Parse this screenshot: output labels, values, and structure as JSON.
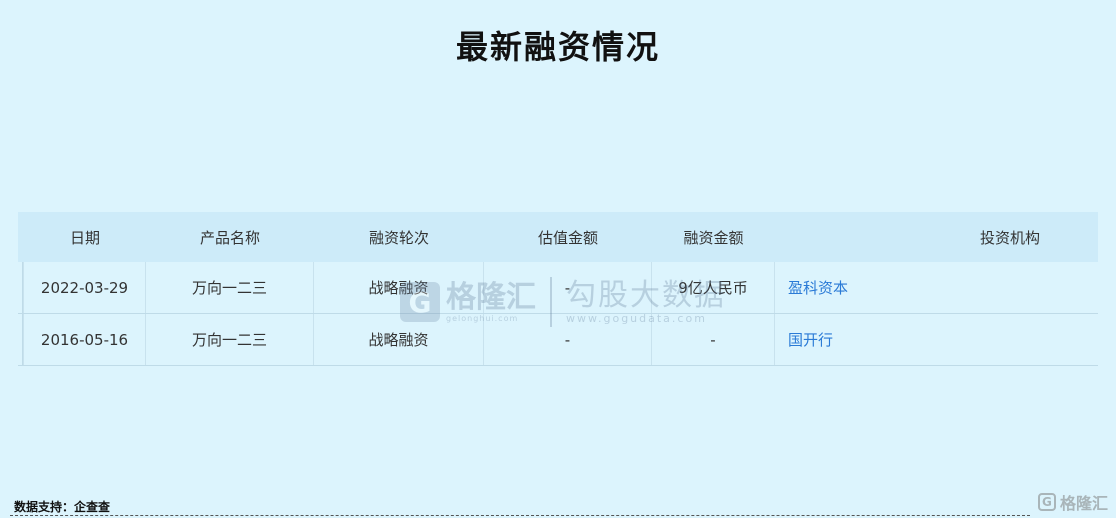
{
  "title": "最新融资情况",
  "table": {
    "headers": [
      "日期",
      "产品名称",
      "融资轮次",
      "估值金额",
      "融资金额",
      "投资机构"
    ],
    "rows": [
      [
        "2022-03-29",
        "万向一二三",
        "战略融资",
        "-",
        "9亿人民币",
        "盈科资本"
      ],
      [
        "2016-05-16",
        "万向一二三",
        "战略融资",
        "-",
        "-",
        "国开行"
      ]
    ]
  },
  "watermark": {
    "logo_letter": "G",
    "brand": "格隆汇",
    "brand_url": "gelonghui.com",
    "brand2": "勾股大数据",
    "url": "www.gogudata.com"
  },
  "footer": {
    "source": "数据支持：企查查"
  },
  "corner": {
    "icon_letter": "G",
    "text": "格隆汇"
  },
  "colors": {
    "background": "#dcf4fd",
    "header_bg": "#cdebf9",
    "link": "#2a7ad6"
  }
}
